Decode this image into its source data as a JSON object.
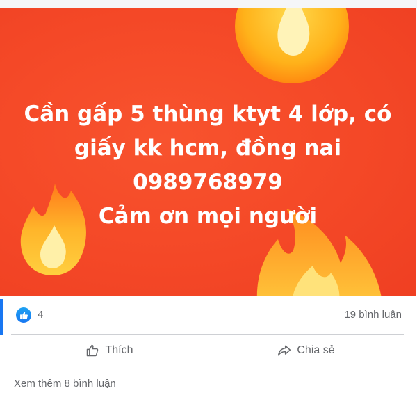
{
  "post": {
    "image_text": {
      "lines": [
        "Cần gấp 5 thùng ktyt 4 lớp, có",
        "giấy kk hcm, đồng nai",
        "0989768979",
        "Cảm ơn mọi người"
      ],
      "background_color": "#f54a28",
      "text_color": "#ffffff"
    },
    "decorations": [
      "fire-emoji-icon",
      "fire-emoji-icon",
      "fire-emoji-icon"
    ]
  },
  "reactions": {
    "icon": "like-icon",
    "count": "4",
    "comments": "19 bình luận"
  },
  "actions": {
    "like": {
      "icon": "thumbs-up-icon",
      "label": "Thích"
    },
    "share": {
      "icon": "share-arrow-icon",
      "label": "Chia sẻ"
    }
  },
  "comments": {
    "view_more": "Xem thêm 8 bình luận"
  },
  "colors": {
    "accent": "#1877f2",
    "secondary_text": "#65676b"
  }
}
